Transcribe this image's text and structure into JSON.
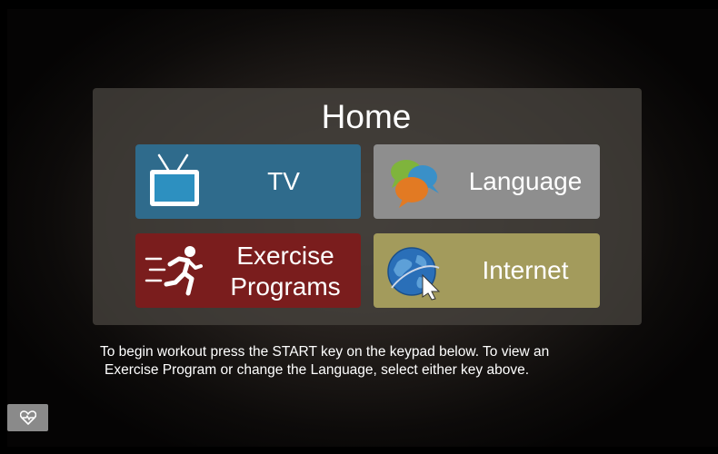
{
  "home": {
    "title": "Home"
  },
  "tiles": {
    "tv": {
      "label": "TV",
      "color": "#2f6b8c"
    },
    "language": {
      "label": "Language",
      "color": "#8e8e8e"
    },
    "exercise": {
      "label_line1": "Exercise",
      "label_line2": "Programs",
      "color": "#7a1d1d"
    },
    "internet": {
      "label": "Internet",
      "color": "#a39b5c"
    }
  },
  "instructions": {
    "line1": "To begin workout press the START key on the keypad below. To view an",
    "line2": "Exercise Program or change the Language, select either key above."
  },
  "icons": {
    "tv": "tv-icon",
    "language": "speech-bubbles-icon",
    "exercise": "running-person-icon",
    "internet": "globe-cursor-icon",
    "heart_rate": "heart-rate-icon"
  }
}
